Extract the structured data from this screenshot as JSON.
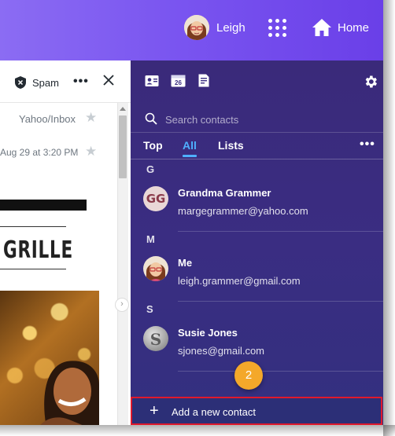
{
  "header": {
    "user_name": "Leigh",
    "home_label": "Home"
  },
  "mail": {
    "spam_label": "Spam",
    "folder_path": "Yahoo/Inbox",
    "message_date": "Aug 29 at 3:20 PM",
    "image_text": "GRILLE"
  },
  "contacts": {
    "search_placeholder": "Search contacts",
    "tabs": [
      {
        "label": "Top",
        "active": false
      },
      {
        "label": "All",
        "active": true
      },
      {
        "label": "Lists",
        "active": false
      }
    ],
    "sections": [
      {
        "letter": "G",
        "name": "Grandma Grammer",
        "email": "margegrammer@yahoo.com",
        "avatar_text": "GG"
      },
      {
        "letter": "M",
        "name": "Me",
        "email": "leigh.grammer@gmail.com"
      },
      {
        "letter": "S",
        "name": "Susie Jones",
        "email": "sjones@gmail.com"
      }
    ],
    "add_label": "Add a new contact",
    "step_number": "2",
    "calendar_day": "26"
  },
  "colors": {
    "accent": "#4fb0ff",
    "panel": "#3a2d82",
    "highlight": "#e0192c",
    "badge": "#f4a82a"
  }
}
